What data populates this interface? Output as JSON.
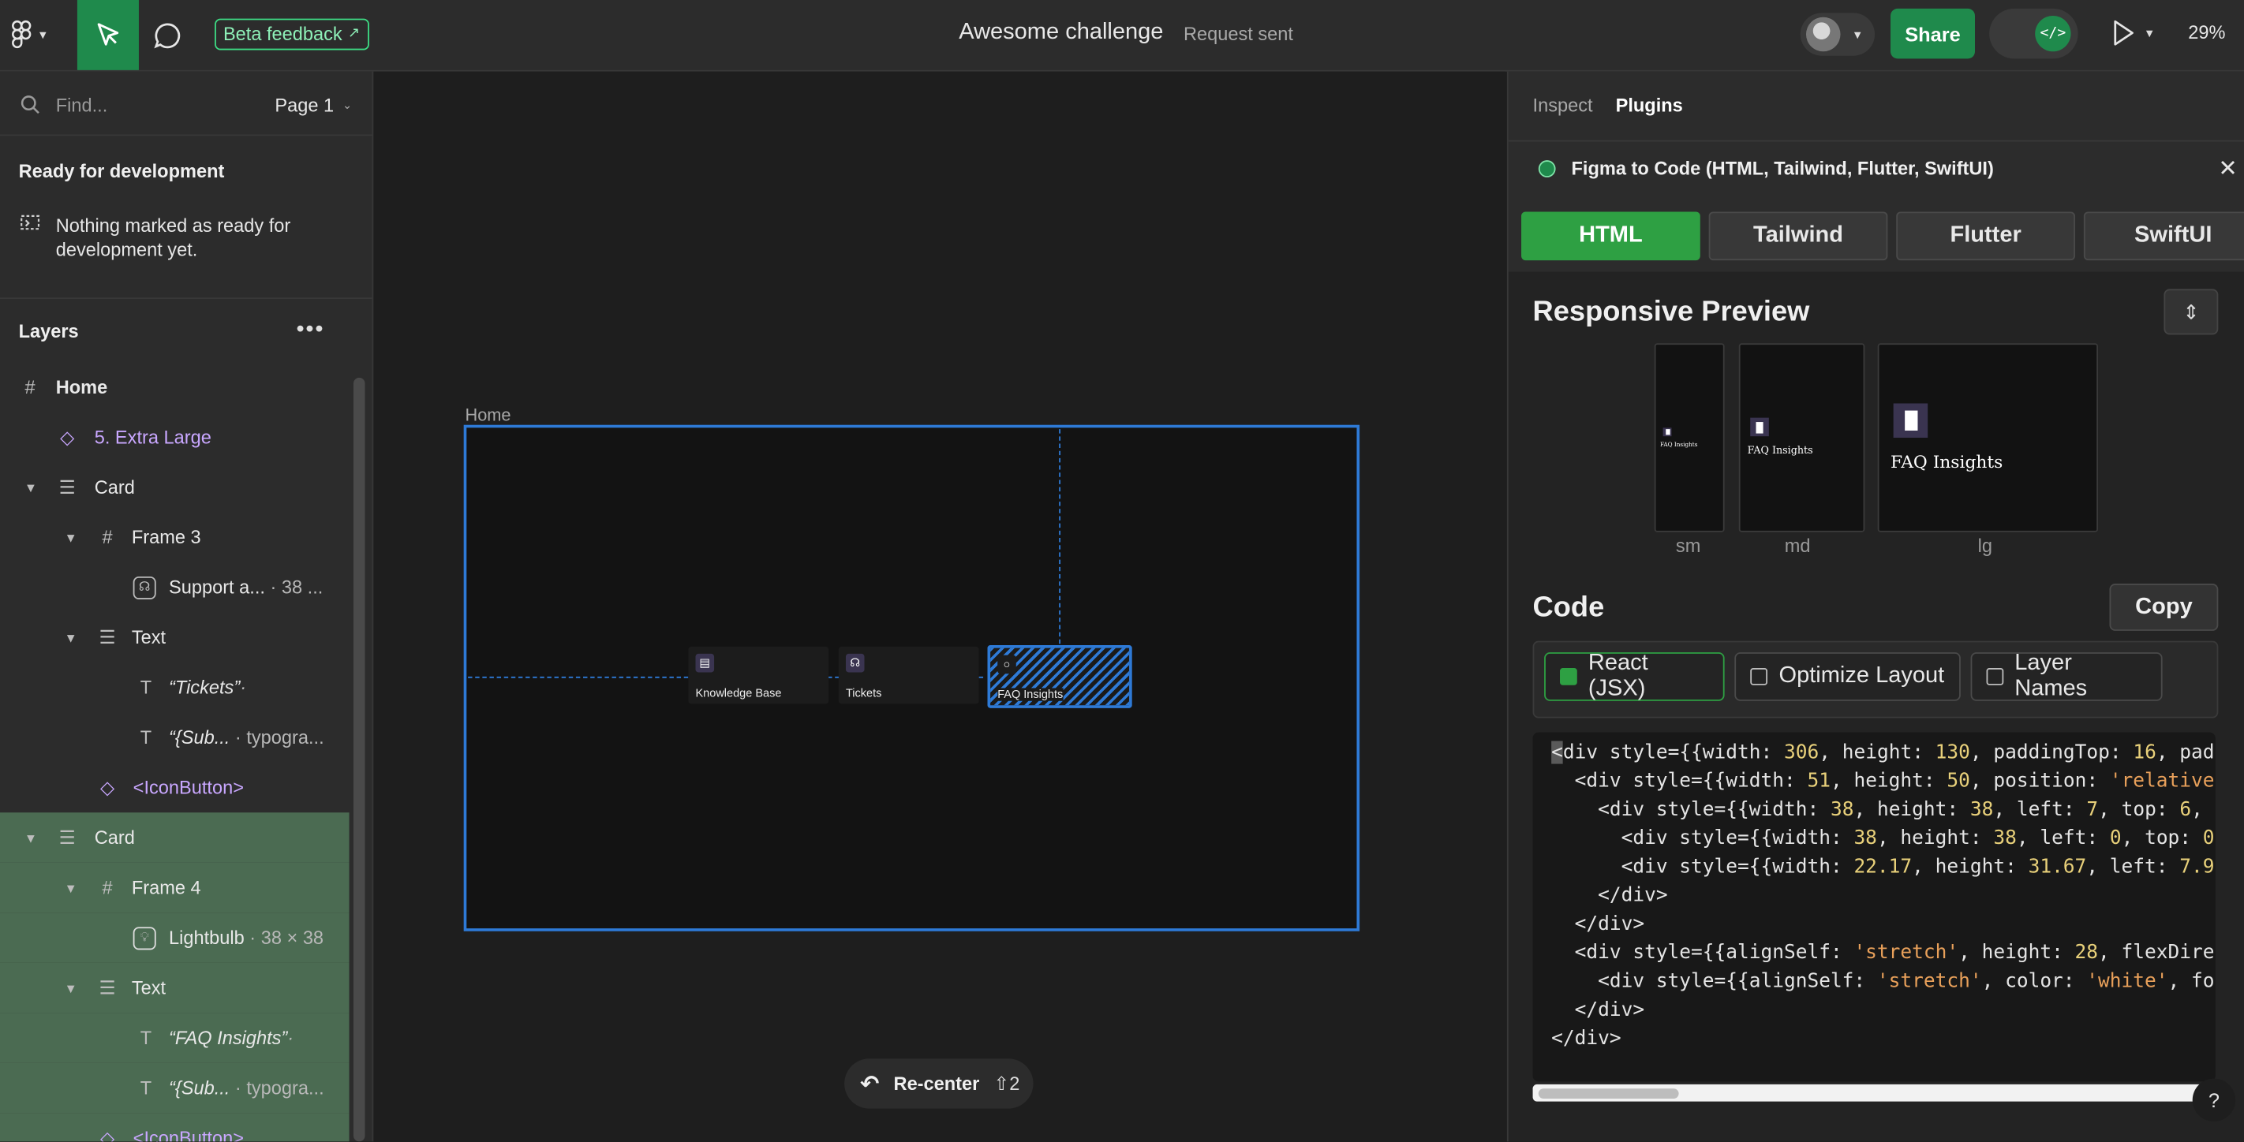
{
  "topbar": {
    "beta_feedback": "Beta feedback",
    "doc_title": "Awesome challenge",
    "request_status": "Request sent",
    "share": "Share",
    "zoom": "29%"
  },
  "left": {
    "find_placeholder": "Find...",
    "page": "Page 1",
    "ready_title": "Ready for development",
    "ready_message": "Nothing marked as ready for development yet.",
    "layers_title": "Layers",
    "layers": [
      {
        "label": "Home",
        "sub": "",
        "icon": "frame-icon"
      },
      {
        "label": "5. Extra Large",
        "sub": "",
        "icon": "component-instance-icon"
      },
      {
        "label": "Card",
        "sub": "",
        "icon": "autolayout-icon"
      },
      {
        "label": "Frame 3",
        "sub": "",
        "icon": "frame-icon"
      },
      {
        "label": "Support a...",
        "sub": " · 38 ...",
        "icon": "support-agent-icon"
      },
      {
        "label": "Text",
        "sub": "",
        "icon": "autolayout-icon"
      },
      {
        "label": "“Tickets”",
        "sub": "·",
        "icon": "text-icon"
      },
      {
        "label": "“{Sub...",
        "sub": " · typogra...",
        "icon": "text-icon"
      },
      {
        "label": "<IconButton>",
        "sub": "",
        "icon": "component-instance-icon"
      },
      {
        "label": "Card",
        "sub": "",
        "icon": "autolayout-icon"
      },
      {
        "label": "Frame 4",
        "sub": "",
        "icon": "frame-icon"
      },
      {
        "label": "Lightbulb",
        "sub": " · 38 × 38",
        "icon": "lightbulb-icon"
      },
      {
        "label": "Text",
        "sub": "",
        "icon": "autolayout-icon"
      },
      {
        "label": "“FAQ Insights”",
        "sub": "·",
        "icon": "text-icon"
      },
      {
        "label": "“{Sub...",
        "sub": " · typogra...",
        "icon": "text-icon"
      },
      {
        "label": "<IconButton>",
        "sub": "",
        "icon": "component-instance-icon"
      }
    ]
  },
  "canvas": {
    "frame_label": "Home",
    "cards": [
      "Knowledge Base",
      "Tickets",
      "FAQ Insights"
    ],
    "recenter": "Re-center",
    "recenter_shortcut": "⇧2"
  },
  "right": {
    "tabs": [
      "Inspect",
      "Plugins"
    ],
    "plugin_name": "Figma to Code (HTML, Tailwind, Flutter, SwiftUI)",
    "frameworks": [
      "HTML",
      "Tailwind",
      "Flutter",
      "SwiftUI"
    ],
    "responsive_title": "Responsive Preview",
    "preview_label": "FAQ Insights",
    "preview_sizes": [
      "sm",
      "md",
      "lg"
    ],
    "code_title": "Code",
    "copy": "Copy",
    "options": [
      "React (JSX)",
      "Optimize Layout",
      "Layer Names"
    ],
    "help": "?"
  },
  "colors": {
    "accent_green": "#1f8a4c",
    "selection_blue": "#2e7ad6",
    "panel_bg": "#2c2c2c"
  }
}
